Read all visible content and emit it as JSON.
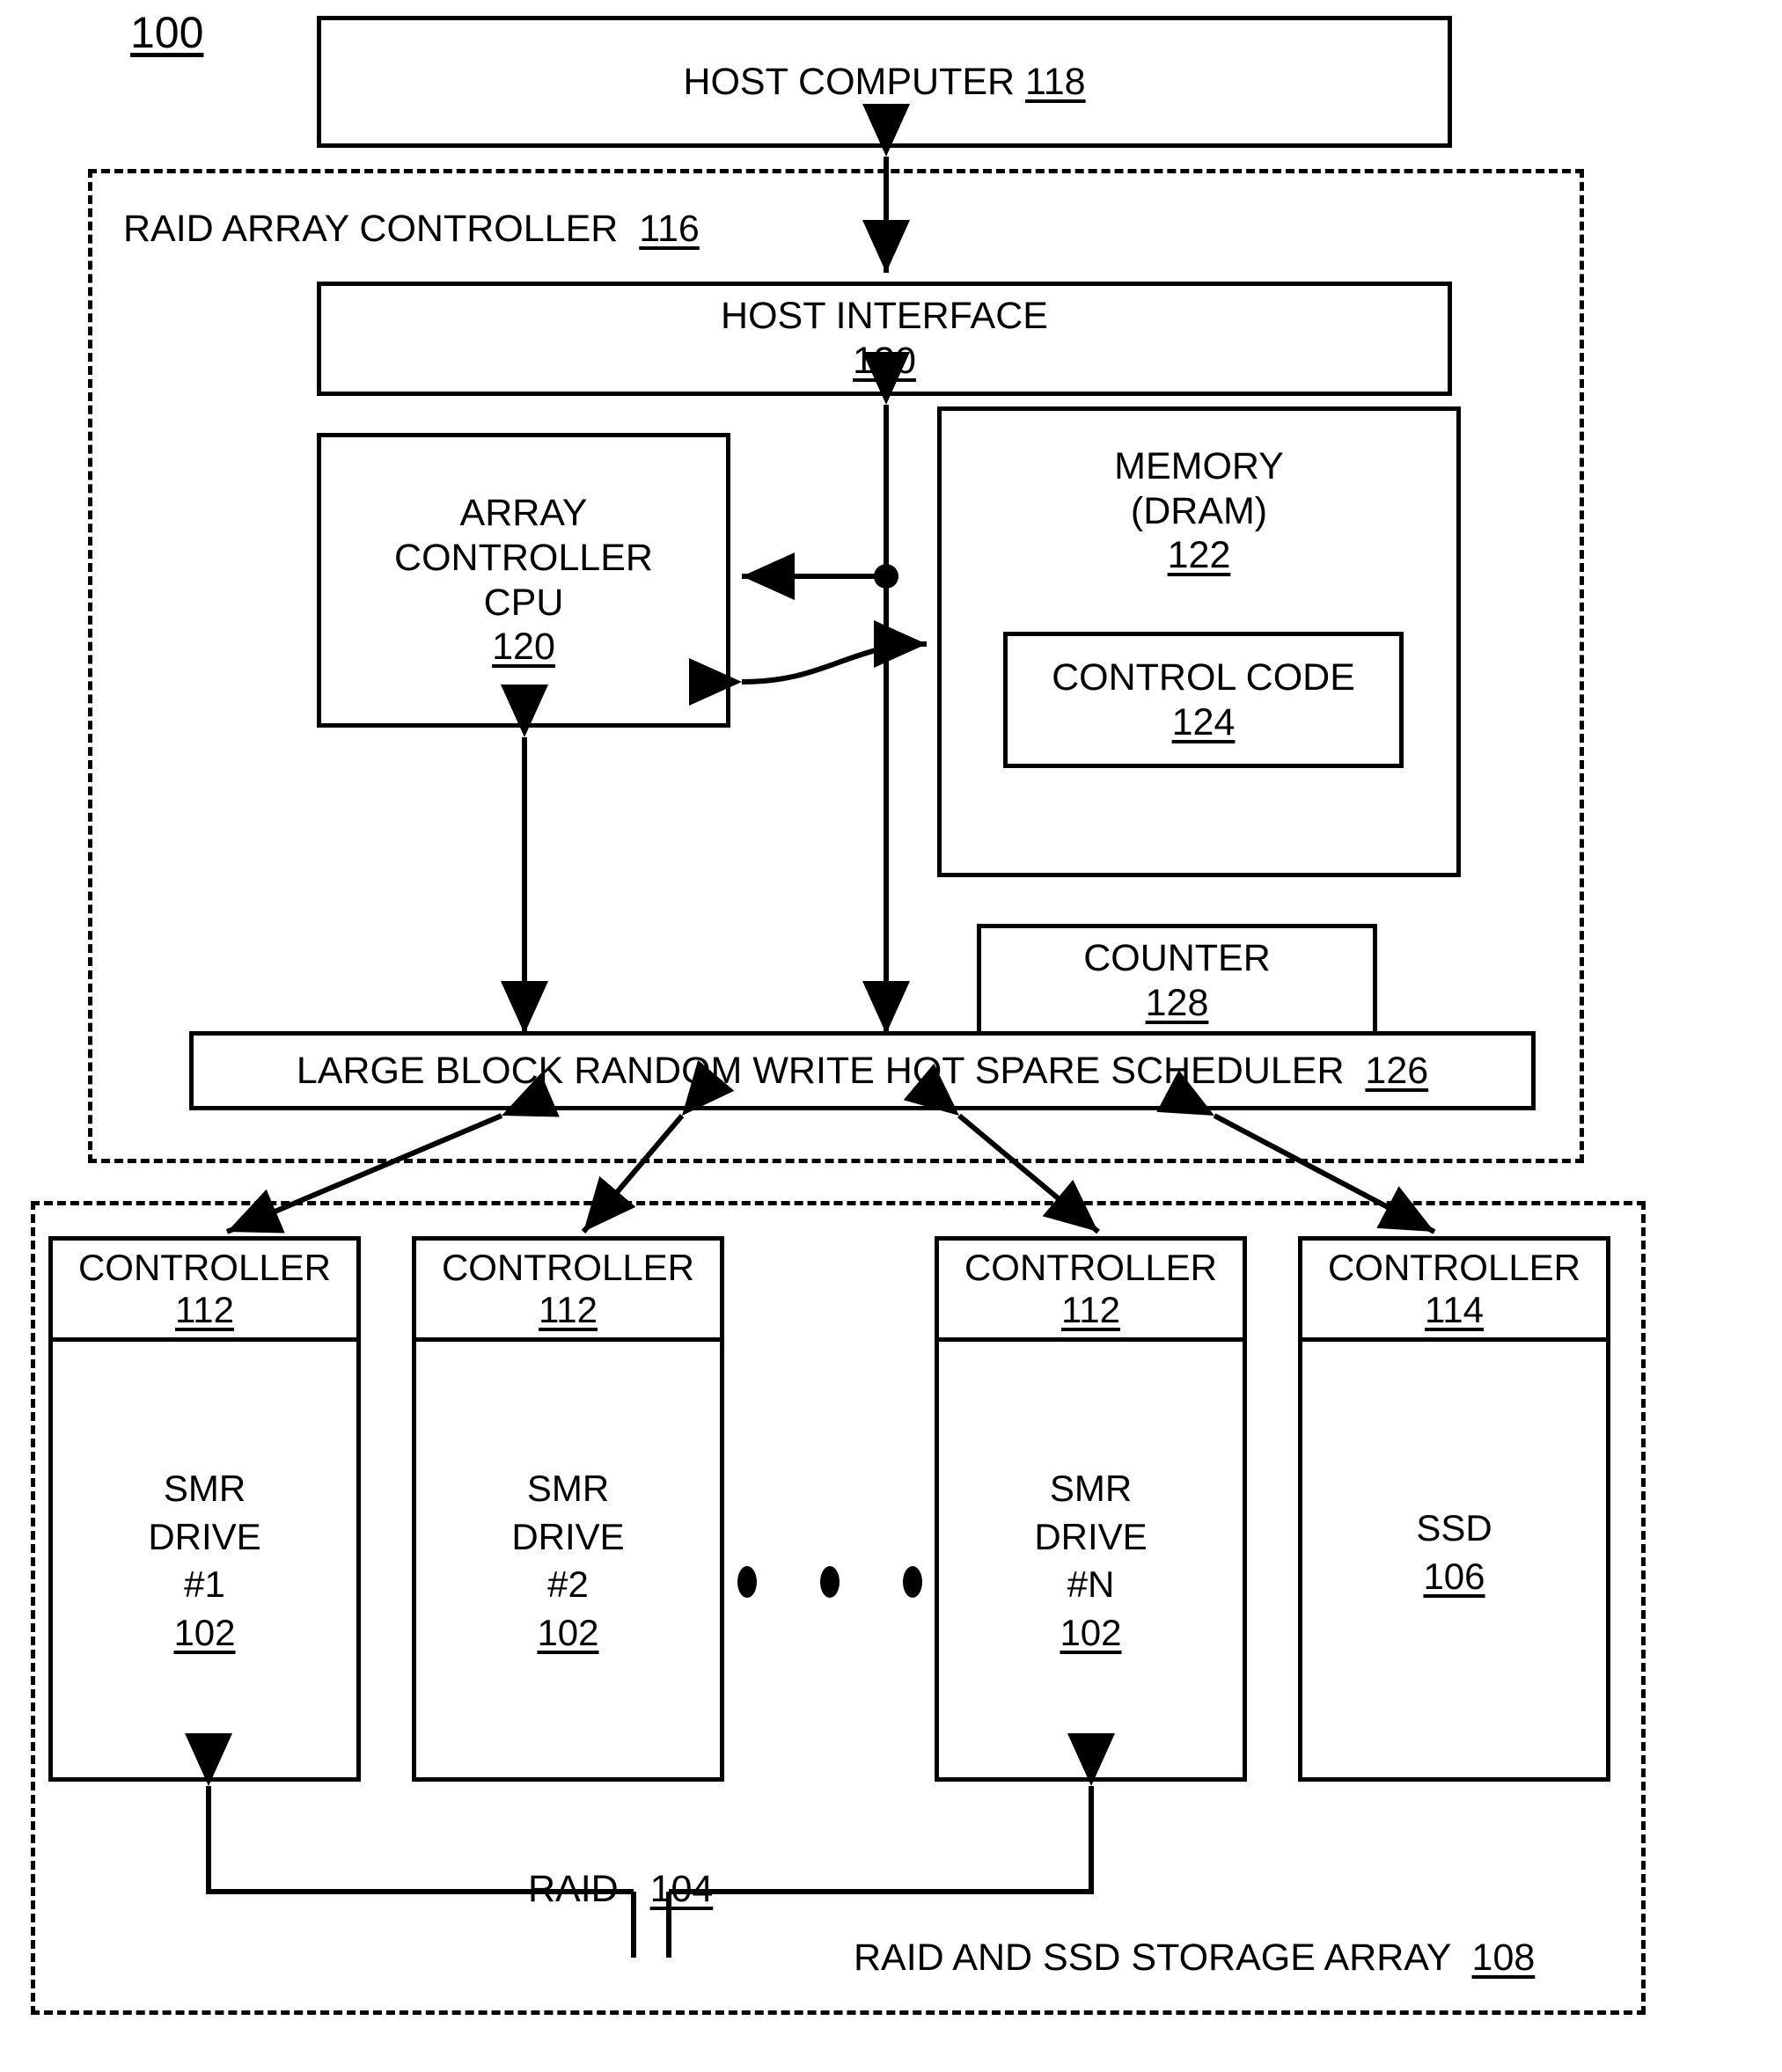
{
  "figure": {
    "number": "100"
  },
  "host_computer": {
    "label": "HOST COMPUTER",
    "ref": "118"
  },
  "raid_array_controller": {
    "label": "RAID ARRAY CONTROLLER",
    "ref": "116",
    "host_interface": {
      "label": "HOST INTERFACE",
      "ref": "130"
    },
    "array_controller_cpu": {
      "line1": "ARRAY",
      "line2": "CONTROLLER",
      "line3": "CPU",
      "ref": "120"
    },
    "memory": {
      "line1": "MEMORY",
      "line2": "(DRAM)",
      "ref": "122",
      "control_code": {
        "label": "CONTROL CODE",
        "ref": "124"
      }
    },
    "counter": {
      "label": "COUNTER",
      "ref": "128"
    },
    "scheduler": {
      "label": "LARGE BLOCK RANDOM WRITE HOT SPARE SCHEDULER",
      "ref": "126"
    }
  },
  "storage_array": {
    "label": "RAID AND SSD STORAGE ARRAY",
    "ref": "108",
    "raid_label": "RAID",
    "raid_ref": "104",
    "drives": [
      {
        "controller_label": "CONTROLLER",
        "controller_ref": "112",
        "name_line1": "SMR",
        "name_line2": "DRIVE",
        "name_line3": "#1",
        "ref": "102"
      },
      {
        "controller_label": "CONTROLLER",
        "controller_ref": "112",
        "name_line1": "SMR",
        "name_line2": "DRIVE",
        "name_line3": "#2",
        "ref": "102"
      },
      {
        "controller_label": "CONTROLLER",
        "controller_ref": "112",
        "name_line1": "SMR",
        "name_line2": "DRIVE",
        "name_line3": "#N",
        "ref": "102"
      }
    ],
    "ssd": {
      "controller_label": "CONTROLLER",
      "controller_ref": "114",
      "name_line1": "SSD",
      "ref": "106"
    },
    "ellipsis_dot_count": 3
  },
  "colors": {
    "line": "#000000",
    "background": "#ffffff"
  }
}
